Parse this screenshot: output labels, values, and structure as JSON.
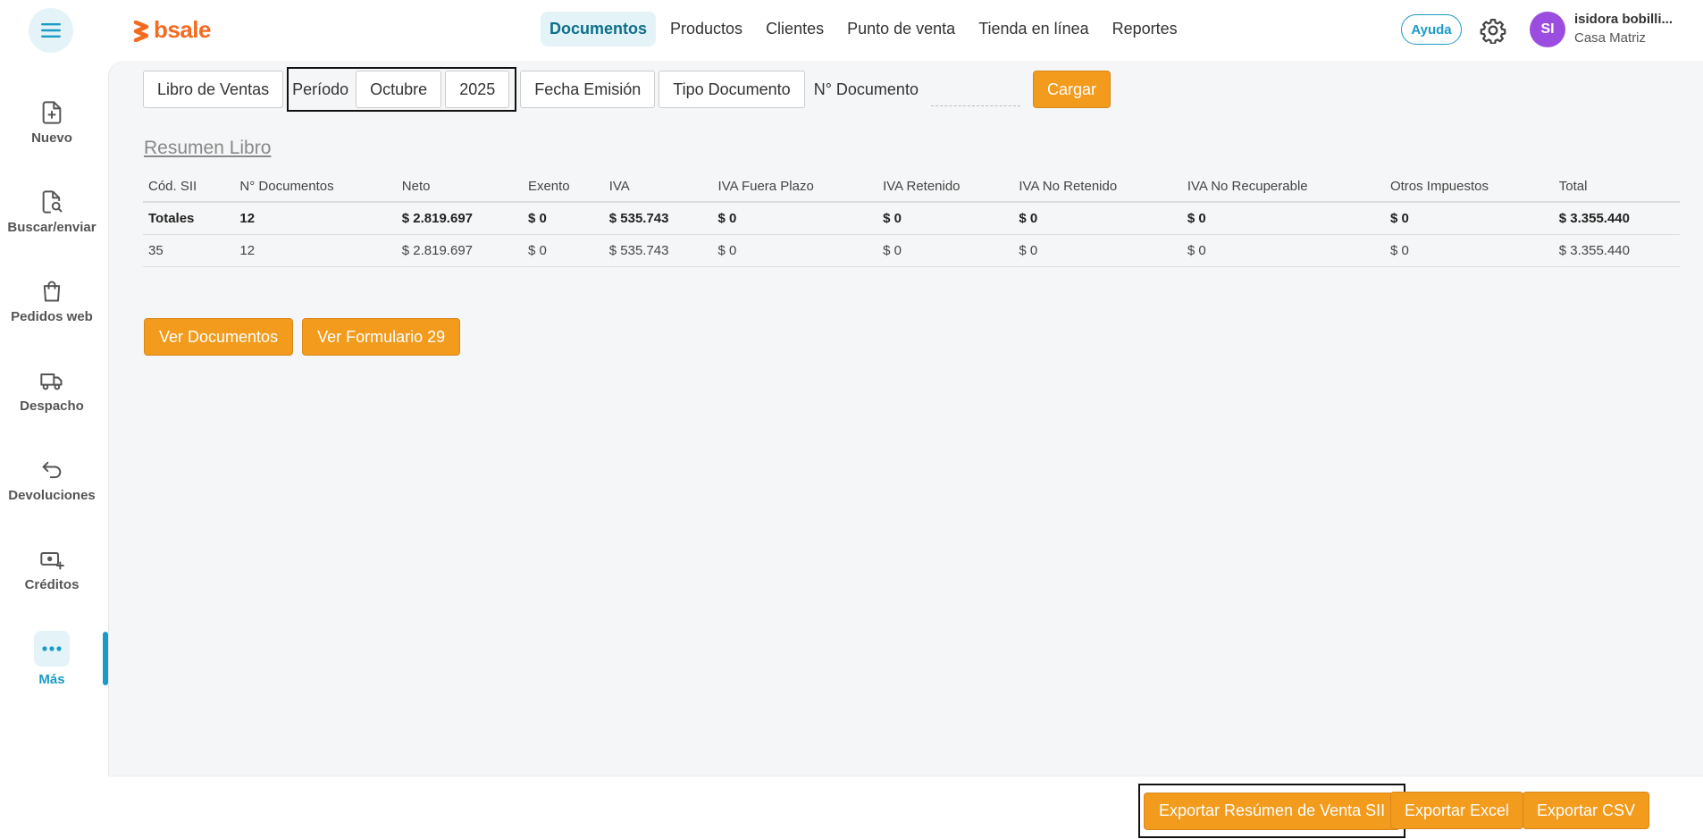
{
  "header": {
    "logo_text": "bsale",
    "nav": [
      {
        "label": "Documentos",
        "active": true
      },
      {
        "label": "Productos"
      },
      {
        "label": "Clientes"
      },
      {
        "label": "Punto de venta"
      },
      {
        "label": "Tienda en línea"
      },
      {
        "label": "Reportes"
      }
    ],
    "help_label": "Ayuda",
    "avatar_initials": "SI",
    "user_name": "isidora bobilli...",
    "user_branch": "Casa Matriz"
  },
  "sidebar": {
    "items": [
      {
        "label": "Nuevo",
        "icon": "file-plus-icon"
      },
      {
        "label": "Buscar/enviar",
        "icon": "file-search-icon"
      },
      {
        "label": "Pedidos web",
        "icon": "shopping-bag-icon"
      },
      {
        "label": "Despacho",
        "icon": "truck-icon"
      },
      {
        "label": "Devoluciones",
        "icon": "return-arrow-icon"
      },
      {
        "label": "Créditos",
        "icon": "cash-plus-icon"
      },
      {
        "label": "Más",
        "icon": "more-dots-icon",
        "active": true
      }
    ]
  },
  "filters": {
    "libro": "Libro de Ventas",
    "periodo_label": "Período",
    "month": "Octubre",
    "year": "2025",
    "fecha": "Fecha Emisión",
    "tipo": "Tipo Documento",
    "doc_label": "N° Documento",
    "doc_value": "",
    "cargar": "Cargar"
  },
  "resumen": {
    "title": "Resumen Libro",
    "columns": [
      "Cód. SII",
      "N° Documentos",
      "Neto",
      "Exento",
      "IVA",
      "IVA Fuera Plazo",
      "IVA Retenido",
      "IVA No Retenido",
      "IVA No Recuperable",
      "Otros Impuestos",
      "Total"
    ],
    "totals": [
      "Totales",
      "12",
      "$ 2.819.697",
      "$ 0",
      "$ 535.743",
      "$ 0",
      "$ 0",
      "$ 0",
      "$ 0",
      "$ 0",
      "$ 3.355.440"
    ],
    "rows": [
      [
        "35",
        "12",
        "$ 2.819.697",
        "$ 0",
        "$ 535.743",
        "$ 0",
        "$ 0",
        "$ 0",
        "$ 0",
        "$ 0",
        "$ 3.355.440"
      ]
    ]
  },
  "actions": {
    "ver_documentos": "Ver Documentos",
    "ver_formulario": "Ver Formulario 29"
  },
  "footer": {
    "export_resumen": "Exportar Resúmen de Venta SII",
    "export_excel": "Exportar Excel",
    "export_csv": "Exportar CSV"
  },
  "colors": {
    "accent": "#1a9bc6",
    "orange": "#f39b1c",
    "brand": "#f26b21",
    "avatar": "#9b4de0"
  }
}
